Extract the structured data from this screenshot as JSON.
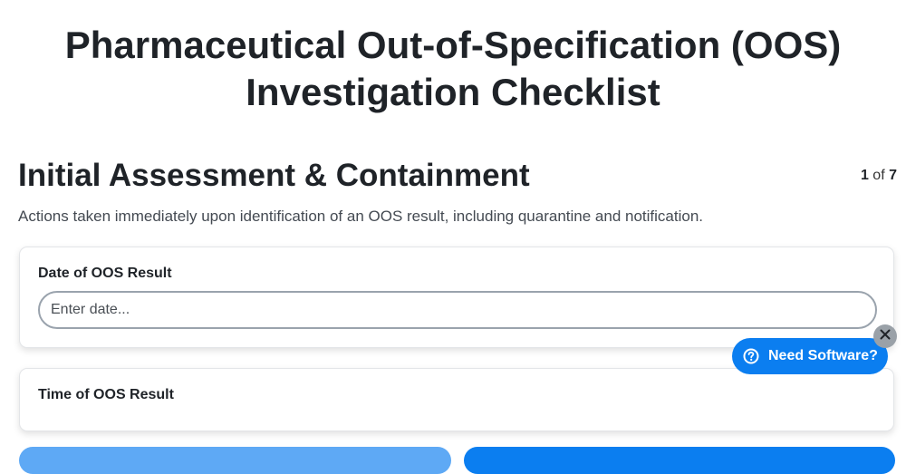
{
  "page": {
    "title_line1": "Pharmaceutical Out-of-Specification (OOS)",
    "title_line2": "Investigation Checklist"
  },
  "section": {
    "title": "Initial Assessment & Containment",
    "current_page": "1",
    "page_separator": "of",
    "total_pages": "7",
    "description": "Actions taken immediately upon identification of an OOS result, including quarantine and notification."
  },
  "fields": [
    {
      "label": "Date of OOS Result",
      "placeholder": "Enter date...",
      "value": ""
    },
    {
      "label": "Time of OOS Result"
    }
  ],
  "floating_help": {
    "label": "Need Software?",
    "icon": "question-circle-icon",
    "close_icon": "close-icon"
  },
  "colors": {
    "primary": "#0b7ef0",
    "primary_light": "#5ea9f5",
    "close_badge": "#9aa1a8",
    "text": "#1f2328"
  }
}
